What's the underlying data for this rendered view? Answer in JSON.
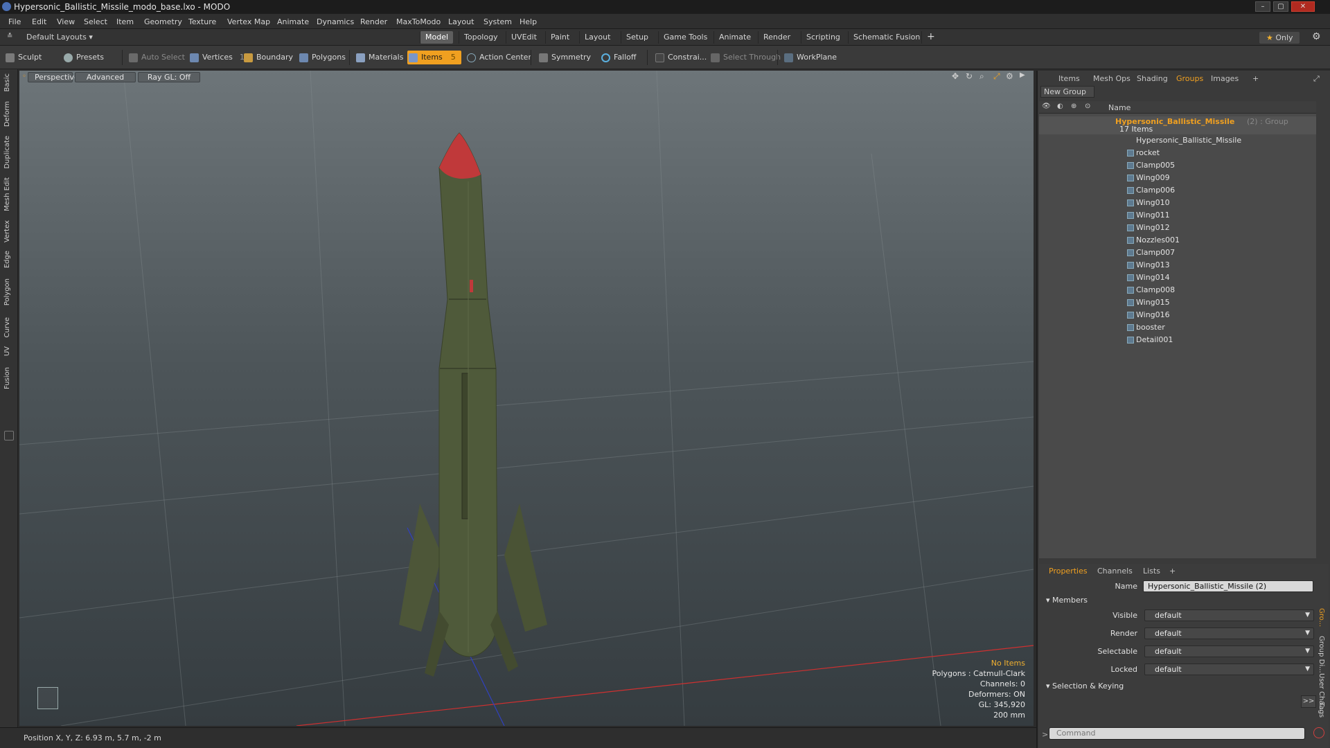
{
  "window": {
    "title": "Hypersonic_Ballistic_Missile_modo_base.lxo - MODO"
  },
  "menu": [
    "File",
    "Edit",
    "View",
    "Select",
    "Item",
    "Geometry",
    "Texture",
    "Vertex Map",
    "Animate",
    "Dynamics",
    "Render",
    "MaxToModo",
    "Layout",
    "System",
    "Help"
  ],
  "layouts": {
    "dropdown": "Default Layouts",
    "tabs": [
      "Model",
      "Topology",
      "UVEdit",
      "Paint",
      "Layout",
      "Setup",
      "Game Tools",
      "Animate",
      "Render",
      "Scripting",
      "Schematic Fusion"
    ],
    "active": "Model",
    "only_label": "Only"
  },
  "toolbar": {
    "sculpt": "Sculpt",
    "presets": "Presets",
    "auto_select": "Auto Select",
    "vertices": "Vertices",
    "vertices_count": "1",
    "boundary": "Boundary",
    "polygons": "Polygons",
    "materials": "Materials",
    "items": "Items",
    "items_count": "5",
    "action_center": "Action Center",
    "symmetry": "Symmetry",
    "falloff": "Falloff",
    "constrain": "Constrai...",
    "select_through": "Select Through",
    "workplane": "WorkPlane"
  },
  "left_tabs": [
    "Basic",
    "Deform",
    "Duplicate",
    "Mesh Edit",
    "Vertex",
    "Edge",
    "Polygon",
    "Curve",
    "UV",
    "Fusion"
  ],
  "viewport": {
    "projection": "Perspective",
    "shading": "Advanced",
    "raygl": "Ray GL: Off",
    "stats": {
      "selection": "No Items",
      "polygons": "Polygons : Catmull-Clark",
      "channels": "Channels: 0",
      "deformers": "Deformers: ON",
      "gl": "GL: 345,920",
      "scale": "200 mm"
    }
  },
  "status": {
    "position": "Position X, Y, Z:  6.93 m, 5.7 m, -2 m"
  },
  "groups_panel": {
    "tabs": [
      "Items",
      "Mesh Ops",
      "Shading",
      "Groups",
      "Images"
    ],
    "active": "Groups",
    "new_group": "New Group",
    "col_name": "Name",
    "group_name": "Hypersonic_Ballistic_Missile",
    "group_suffix": "(2) : Group",
    "item_count": "17 Items",
    "items": [
      "Hypersonic_Ballistic_Missile",
      "rocket",
      "Clamp005",
      "Wing009",
      "Clamp006",
      "Wing010",
      "Wing011",
      "Wing012",
      "Nozzles001",
      "Clamp007",
      "Wing013",
      "Wing014",
      "Clamp008",
      "Wing015",
      "Wing016",
      "booster",
      "Detail001"
    ]
  },
  "properties": {
    "tabs": [
      "Properties",
      "Channels",
      "Lists"
    ],
    "active": "Properties",
    "name_label": "Name",
    "name_value": "Hypersonic_Ballistic_Missile (2)",
    "members": "Members",
    "visible_label": "Visible",
    "visible_value": "default",
    "render_label": "Render",
    "render_value": "default",
    "selectable_label": "Selectable",
    "selectable_value": "default",
    "locked_label": "Locked",
    "locked_value": "default",
    "selection_keying": "Selection & Keying",
    "command_placeholder": "Command",
    "side_tabs": [
      "Gro...",
      "Group Di...",
      "User Cha...",
      "Tags"
    ]
  },
  "colors": {
    "accent": "#f0a020",
    "missile_body": "#4f5a3a",
    "missile_tip": "#c0393a"
  }
}
